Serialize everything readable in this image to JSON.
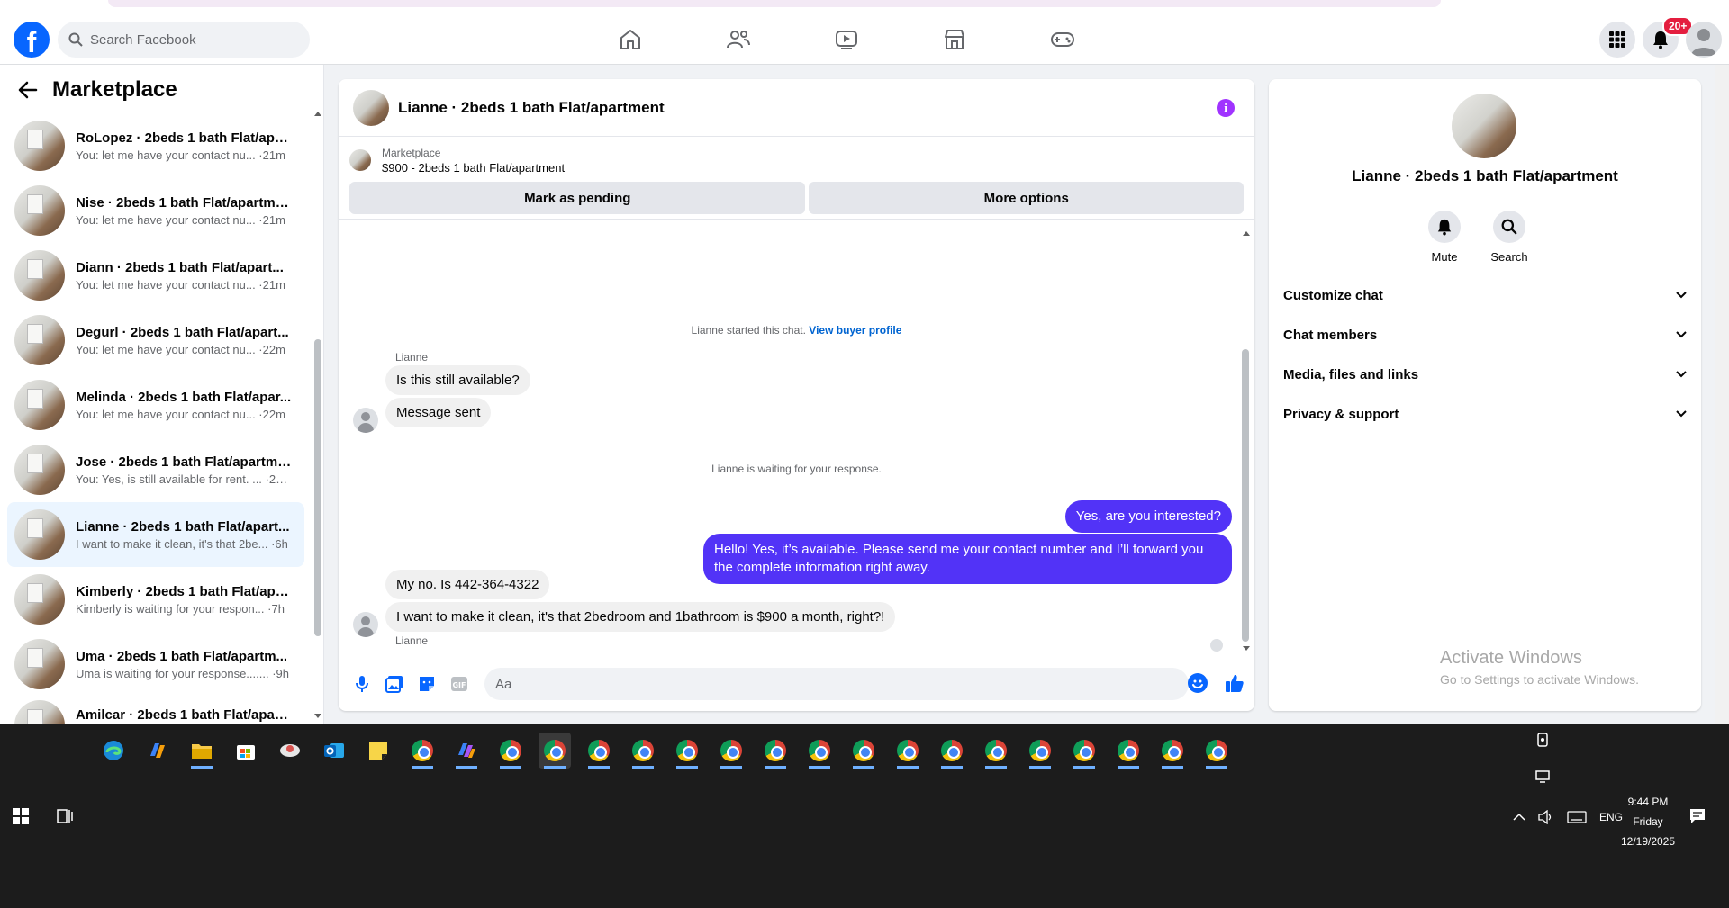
{
  "search": {
    "placeholder": "Search Facebook"
  },
  "notifications": {
    "badge": "20+"
  },
  "sidebar": {
    "title": "Marketplace",
    "conversations": [
      {
        "name": "RoLopez · 2beds 1 bath Flat/apa...",
        "preview": "You: let me have your contact nu... ·21m"
      },
      {
        "name": "Nise · 2beds 1 bath Flat/apartme...",
        "preview": "You: let me have your contact nu... ·21m"
      },
      {
        "name": "Diann · 2beds 1 bath Flat/apart...",
        "preview": "You: let me have your contact nu... ·21m"
      },
      {
        "name": "Degurl · 2beds 1 bath Flat/apart...",
        "preview": "You: let me have your contact nu... ·22m"
      },
      {
        "name": "Melinda · 2beds 1 bath Flat/apar...",
        "preview": "You: let me have your contact nu... ·22m"
      },
      {
        "name": "Jose · 2beds 1 bath Flat/apartme...",
        "preview": "You: Yes, is still available for rent. ... ·23m"
      },
      {
        "name": "Lianne · 2beds 1 bath Flat/apart...",
        "preview": "I want to make it clean, it's that 2be... ·6h"
      },
      {
        "name": "Kimberly · 2beds 1 bath Flat/apa...",
        "preview": "Kimberly is waiting for your respon... ·7h"
      },
      {
        "name": "Uma · 2beds 1 bath Flat/apartm...",
        "preview": "Uma is waiting for your response....... ·9h"
      },
      {
        "name": "Amilcar · 2beds 1 bath Flat/apart...",
        "preview": ""
      }
    ]
  },
  "chat": {
    "title": "Lianne · 2beds 1 bath Flat/apartment",
    "listing": {
      "source": "Marketplace",
      "item": "$900 - 2beds 1 bath Flat/apartment",
      "btn_pending": "Mark as pending",
      "btn_more": "More options"
    },
    "started": "Lianne started this chat.",
    "view_profile": "View buyer profile",
    "sender1": "Lianne",
    "msg1": "Is this still available?",
    "msg2": "Message sent",
    "waiting": "Lianne is waiting for your response.",
    "out1": "Yes, are you interested?",
    "out2": "Hello! Yes, it’s available. Please send me your contact number and I’ll forward you the complete information right away.",
    "sender2": "Lianne",
    "msg3": "My no. Is 442-364-4322",
    "msg4": "I want to make it clean, it's that 2bedroom and 1bathroom is $900 a month, right?!",
    "composer_placeholder": "Aa"
  },
  "rpanel": {
    "title": "Lianne · 2beds 1 bath Flat/apartment",
    "mute": "Mute",
    "search": "Search",
    "sections": [
      "Customize chat",
      "Chat members",
      "Media, files and links",
      "Privacy & support"
    ]
  },
  "watermark": {
    "line1": "Activate Windows",
    "line2": "Go to Settings to activate Windows."
  },
  "taskbar": {
    "time": "9:44 PM",
    "day": "Friday",
    "date": "12/19/2025",
    "lang": "ENG"
  }
}
